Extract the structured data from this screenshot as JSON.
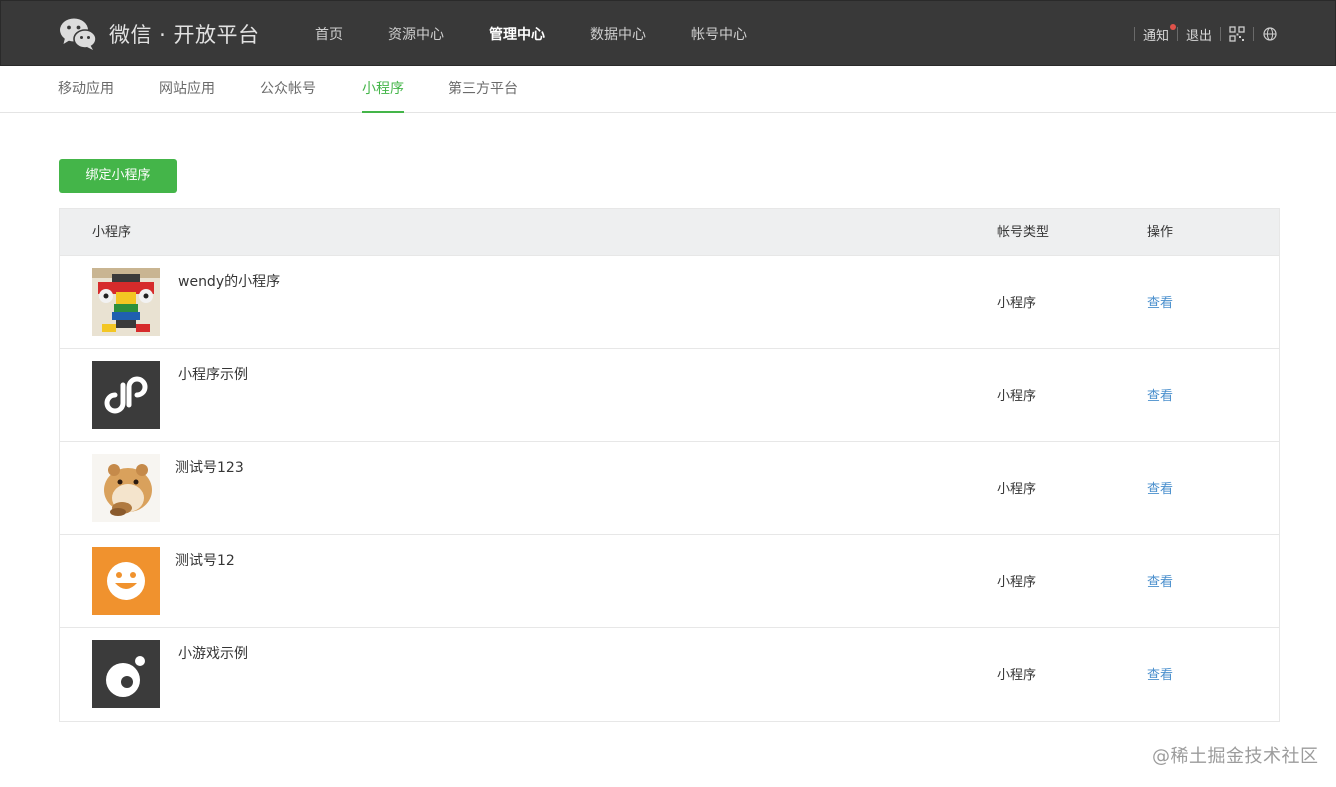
{
  "header": {
    "brand": "微信 · 开放平台",
    "nav": [
      {
        "label": "首页",
        "active": false
      },
      {
        "label": "资源中心",
        "active": false
      },
      {
        "label": "管理中心",
        "active": true
      },
      {
        "label": "数据中心",
        "active": false
      },
      {
        "label": "帐号中心",
        "active": false
      }
    ],
    "notify_label": "通知",
    "logout_label": "退出",
    "icons": [
      "wechat-logo-icon",
      "qrcode-icon",
      "globe-icon"
    ],
    "notify_dot_color": "#e0524a"
  },
  "subnav": {
    "tabs": [
      {
        "label": "移动应用",
        "active": false
      },
      {
        "label": "网站应用",
        "active": false
      },
      {
        "label": "公众帐号",
        "active": false
      },
      {
        "label": "小程序",
        "active": true
      },
      {
        "label": "第三方平台",
        "active": false
      }
    ],
    "active_color": "#44b549"
  },
  "bind_button": {
    "label": "绑定小程序",
    "color": "#44b549"
  },
  "table": {
    "headers": {
      "name": "小程序",
      "type": "帐号类型",
      "action": "操作"
    },
    "rows": [
      {
        "name": "wendy的小程序",
        "type": "小程序",
        "action": "查看",
        "avatar": "lego-photo"
      },
      {
        "name": "小程序示例",
        "type": "小程序",
        "action": "查看",
        "avatar": "miniprogram-logo-icon"
      },
      {
        "name": "测试号123",
        "type": "小程序",
        "action": "查看",
        "avatar": "hamster-photo"
      },
      {
        "name": "测试号12",
        "type": "小程序",
        "action": "查看",
        "avatar": "smiley-face-icon"
      },
      {
        "name": "小游戏示例",
        "type": "小程序",
        "action": "查看",
        "avatar": "minigame-logo-icon"
      }
    ],
    "link_color": "#4a8fcd"
  },
  "watermark": "@稀土掘金技术社区"
}
